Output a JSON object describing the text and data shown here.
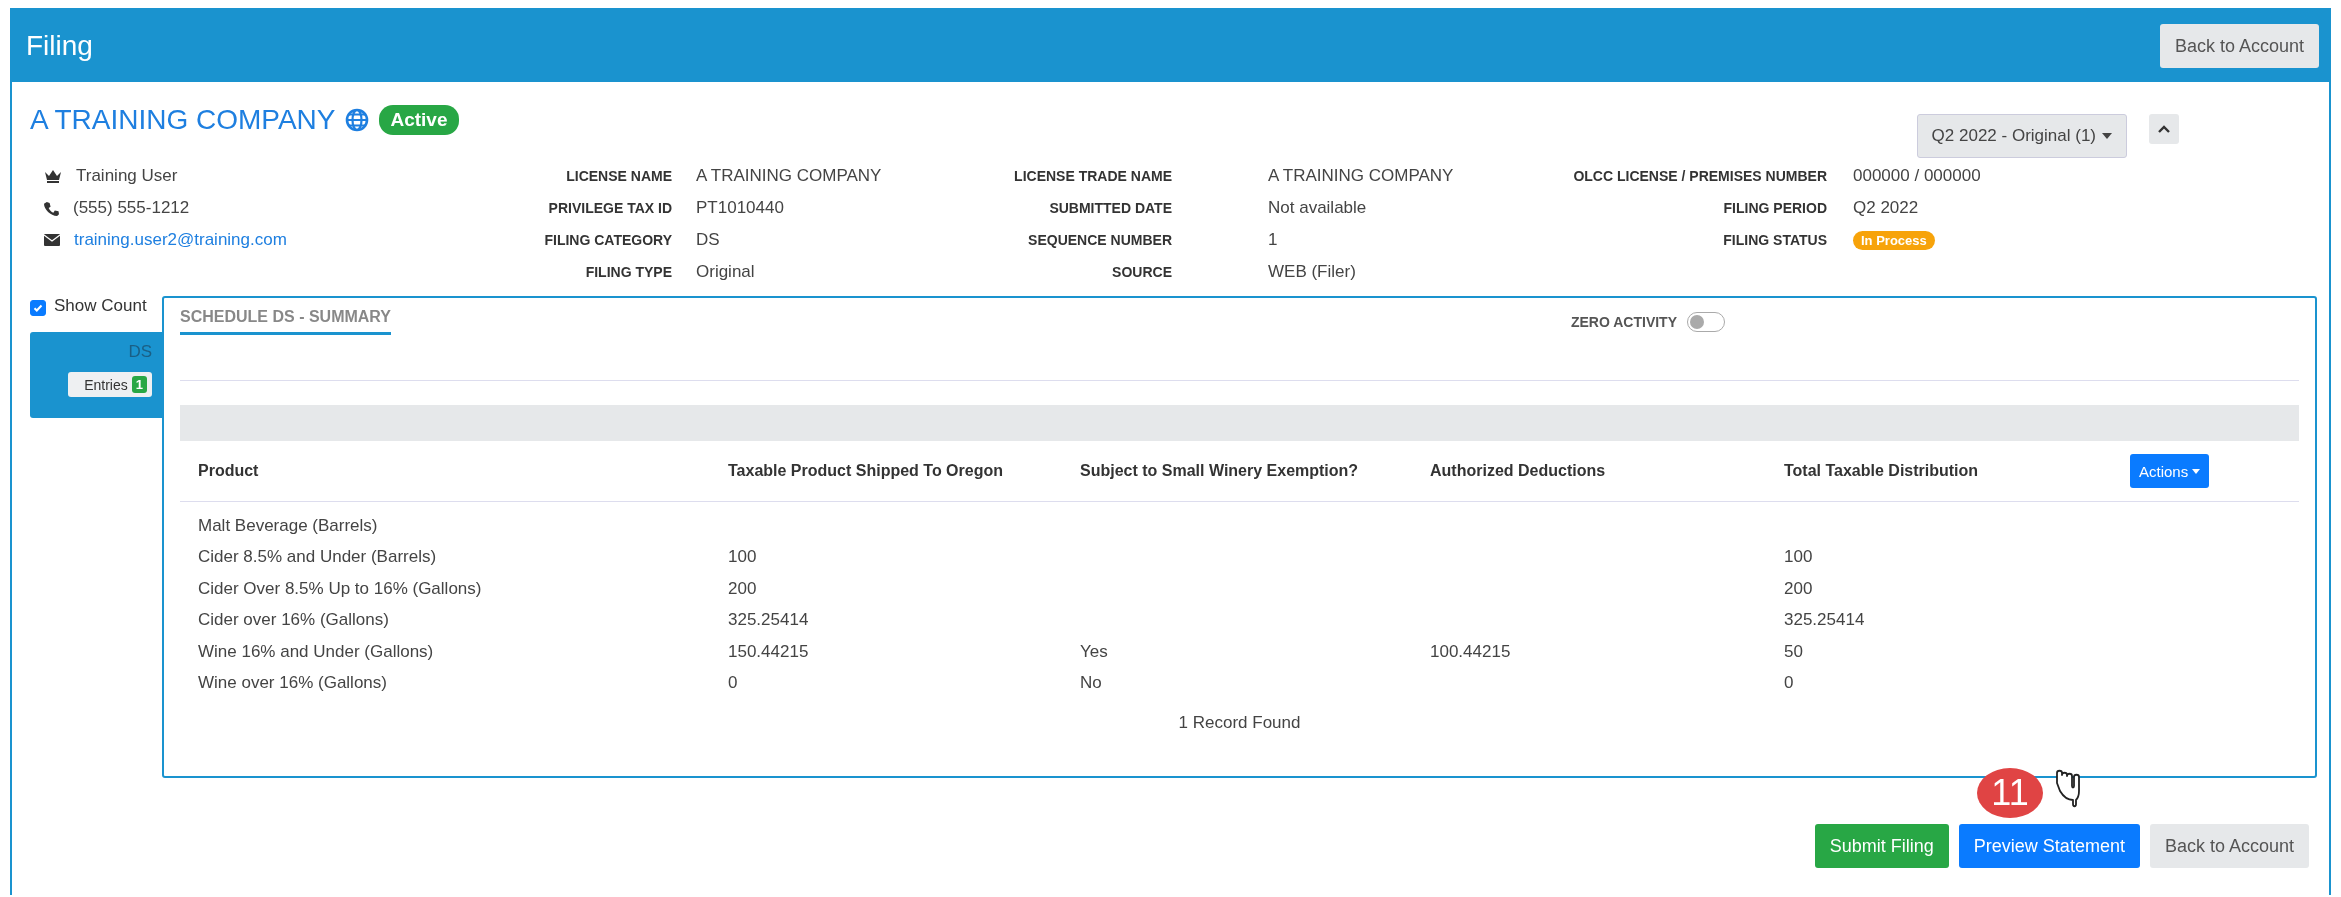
{
  "header": {
    "title": "Filing",
    "back_button": "Back to Account"
  },
  "company": {
    "name": "A TRAINING COMPANY",
    "status": "Active"
  },
  "period_select": {
    "value": "Q2 2022 - Original (1)"
  },
  "contact": [
    {
      "kind": "user",
      "text": "Training User"
    },
    {
      "kind": "phone",
      "text": "(555) 555-1212"
    },
    {
      "kind": "email",
      "text": "training.user2@training.com"
    }
  ],
  "details": [
    [
      {
        "label": "LICENSE NAME",
        "value": "A TRAINING COMPANY"
      },
      {
        "label": "LICENSE TRADE NAME",
        "value": "A TRAINING COMPANY"
      },
      {
        "label": "OLCC LICENSE / PREMISES NUMBER",
        "value": "000000 / 000000"
      }
    ],
    [
      {
        "label": "PRIVILEGE TAX ID",
        "value": "PT1010440"
      },
      {
        "label": "SUBMITTED DATE",
        "value": "Not available"
      },
      {
        "label": "FILING PERIOD",
        "value": "Q2 2022"
      }
    ],
    [
      {
        "label": "FILING CATEGORY",
        "value": "DS"
      },
      {
        "label": "SEQUENCE NUMBER",
        "value": "1"
      },
      {
        "label": "FILING STATUS",
        "value": "In Process",
        "kind": "badge"
      }
    ],
    [
      {
        "label": "FILING TYPE",
        "value": "Original"
      },
      {
        "label": "SOURCE",
        "value": "WEB (Filer)"
      }
    ]
  ],
  "show_count": {
    "label": "Show Count",
    "checked": true
  },
  "schedules": [
    {
      "name": "DS",
      "entries_label": "Entries",
      "count": "1",
      "selected": true
    }
  ],
  "summary": {
    "title": "SCHEDULE DS - SUMMARY",
    "zero_activity": {
      "label": "ZERO ACTIVITY",
      "on": false
    },
    "columns": [
      "Product",
      "Taxable Product Shipped To Oregon",
      "Subject to Small Winery Exemption?",
      "Authorized Deductions",
      "Total Taxable Distribution"
    ],
    "actions": "Actions",
    "rows": [
      [
        "Malt Beverage (Barrels)",
        "",
        "",
        "",
        ""
      ],
      [
        "Cider 8.5% and Under (Barrels)",
        "100",
        "",
        "",
        "100"
      ],
      [
        "Cider Over 8.5% Up to 16% (Gallons)",
        "200",
        "",
        "",
        "200"
      ],
      [
        "Cider over 16% (Gallons)",
        "325.25414",
        "",
        "",
        "325.25414"
      ],
      [
        "Wine 16% and Under (Gallons)",
        "150.44215",
        "Yes",
        "100.44215",
        "50"
      ],
      [
        "Wine over 16% (Gallons)",
        "0",
        "No",
        "",
        "0"
      ]
    ],
    "footer": "1 Record Found"
  },
  "buttons": [
    {
      "label": "Submit Filing",
      "kind": "success"
    },
    {
      "label": "Preview Statement",
      "kind": "primary"
    },
    {
      "label": "Back to Account",
      "kind": "secondary"
    }
  ],
  "callout": {
    "number": "11"
  }
}
